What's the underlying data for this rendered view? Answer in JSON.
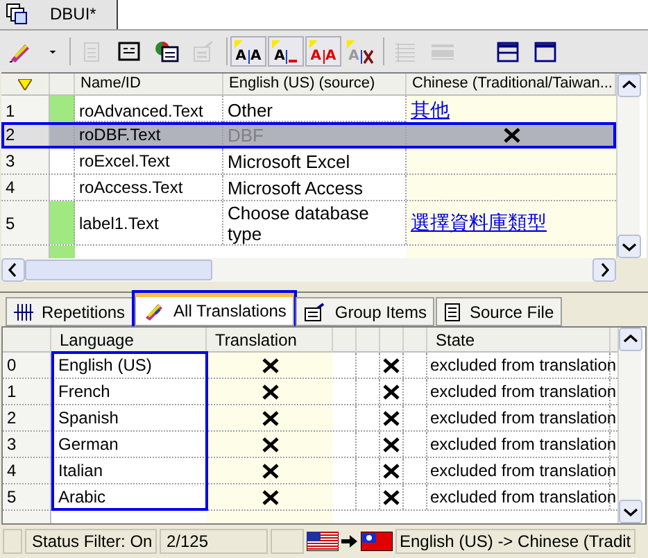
{
  "document_tab": {
    "title": "DBUI*",
    "selected": true
  },
  "toolbar": [
    {
      "kind": "translate",
      "disabled": false,
      "pressed": false
    },
    {
      "kind": "dropdown",
      "disabled": false,
      "pressed": false
    },
    {
      "kind": "page",
      "disabled": true,
      "pressed": false
    },
    {
      "kind": "form",
      "disabled": false,
      "pressed": false
    },
    {
      "kind": "color-form",
      "disabled": false,
      "pressed": false
    },
    {
      "kind": "tools",
      "disabled": true,
      "pressed": false
    },
    {
      "kind": "text-pair",
      "disabled": false,
      "pressed": true,
      "letters": [
        "A",
        "A"
      ]
    },
    {
      "kind": "text-blank",
      "disabled": false,
      "pressed": true,
      "letters": [
        "A"
      ]
    },
    {
      "kind": "text-red",
      "disabled": false,
      "pressed": true,
      "letters": [
        "A",
        "A"
      ]
    },
    {
      "kind": "text-cross",
      "disabled": false,
      "pressed": false,
      "letters": [
        "A"
      ]
    },
    {
      "kind": "list",
      "disabled": true,
      "pressed": false
    },
    {
      "kind": "bar",
      "disabled": true,
      "pressed": false
    },
    {
      "kind": "window-split",
      "disabled": false,
      "pressed": false
    },
    {
      "kind": "window",
      "disabled": false,
      "pressed": false
    }
  ],
  "strings_table": {
    "columns": [
      "Name/ID",
      "English (US) (source)",
      "Chinese (Traditional/Taiwan..."
    ],
    "rows": [
      {
        "index": "1",
        "name": "roAdvanced.Text",
        "source": "Other",
        "translation": "其他",
        "translated": true,
        "excluded": false,
        "selected": false
      },
      {
        "index": "2",
        "name": "roDBF.Text",
        "source": "DBF",
        "translated": false,
        "excluded": true,
        "selected": true
      },
      {
        "index": "3",
        "name": "roExcel.Text",
        "source": "Microsoft Excel",
        "translated": false,
        "excluded": false,
        "selected": false
      },
      {
        "index": "4",
        "name": "roAccess.Text",
        "source": "Microsoft Access",
        "translated": false,
        "excluded": false,
        "selected": false
      },
      {
        "index": "5",
        "name": "label1.Text",
        "source": "Choose database type",
        "translation": "選擇資料庫類型",
        "translated": true,
        "excluded": false,
        "selected": false
      }
    ]
  },
  "detail_tabs": [
    {
      "label": "Repetitions",
      "kind": "repetitions",
      "selected": false
    },
    {
      "label": "All Translations",
      "kind": "translations",
      "selected": true
    },
    {
      "label": "Group Items",
      "kind": "group",
      "selected": false
    },
    {
      "label": "Source File",
      "kind": "file",
      "selected": false
    }
  ],
  "translations_table": {
    "columns": [
      "Language",
      "Translation",
      "State"
    ],
    "rows": [
      {
        "index": "0",
        "language": "English (US)",
        "excluded": true,
        "state": "excluded from translation"
      },
      {
        "index": "1",
        "language": "French",
        "excluded": true,
        "state": "excluded from translation"
      },
      {
        "index": "2",
        "language": "Spanish",
        "excluded": true,
        "state": "excluded from translation"
      },
      {
        "index": "3",
        "language": "German",
        "excluded": true,
        "state": "excluded from translation"
      },
      {
        "index": "4",
        "language": "Italian",
        "excluded": true,
        "state": "excluded from translation"
      },
      {
        "index": "5",
        "language": "Arabic",
        "excluded": true,
        "state": "excluded from translation"
      }
    ]
  },
  "status_bar": {
    "filter": "Status Filter: On",
    "position": "2/125",
    "languages": "English (US) -> Chinese (Tradit"
  }
}
